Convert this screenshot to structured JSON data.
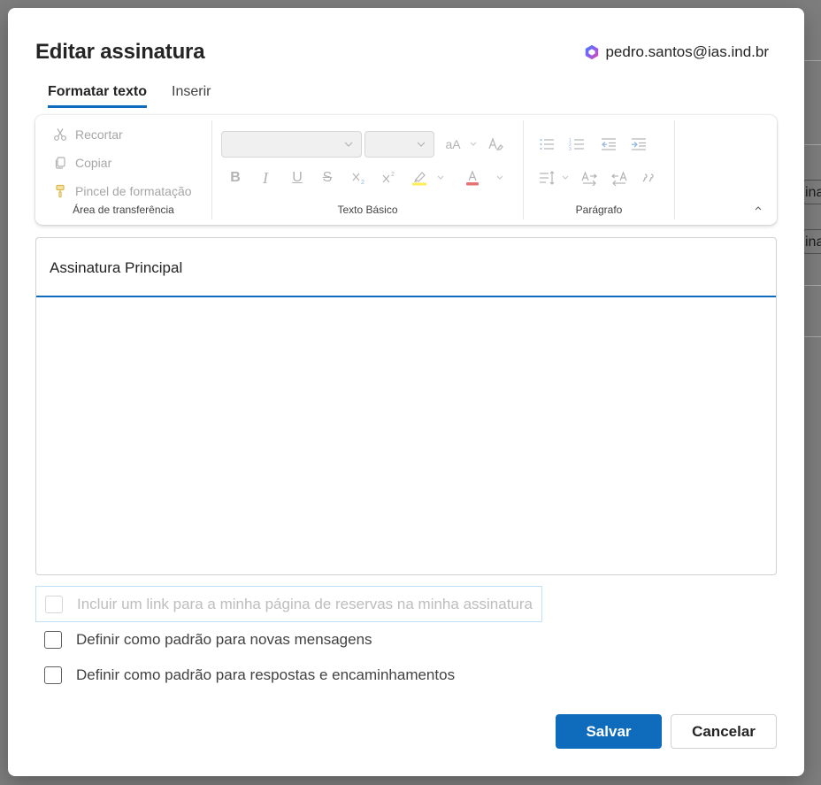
{
  "background": {
    "partial_texts": [
      "ina",
      "ina"
    ]
  },
  "dialog": {
    "title": "Editar assinatura",
    "account_email": "pedro.santos@ias.ind.br"
  },
  "tabs": [
    {
      "label": "Formatar texto",
      "active": true
    },
    {
      "label": "Inserir",
      "active": false
    }
  ],
  "ribbon": {
    "clipboard": {
      "label": "Área de transferência",
      "items": [
        {
          "label": "Recortar",
          "icon": "scissors-icon"
        },
        {
          "label": "Copiar",
          "icon": "copy-icon"
        },
        {
          "label": "Pincel de formatação",
          "icon": "format-painter-icon"
        }
      ]
    },
    "basic_text": {
      "label": "Texto Básico",
      "font_size_button": "aA",
      "buttons": [
        "B",
        "I",
        "U",
        "S"
      ]
    },
    "paragraph": {
      "label": "Parágrafo"
    }
  },
  "editor": {
    "signature_name": "Assinatura Principal"
  },
  "options": [
    {
      "label": "Incluir um link para a minha página de reservas na minha assinatura",
      "disabled": true,
      "checked": false
    },
    {
      "label": "Definir como padrão para novas mensagens",
      "disabled": false,
      "checked": false
    },
    {
      "label": "Definir como padrão para respostas e encaminhamentos",
      "disabled": false,
      "checked": false
    }
  ],
  "actions": {
    "save": "Salvar",
    "cancel": "Cancelar"
  },
  "colors": {
    "accent": "#0f6cbd",
    "highlight": "#ffee58",
    "font_color": "#e57373"
  }
}
